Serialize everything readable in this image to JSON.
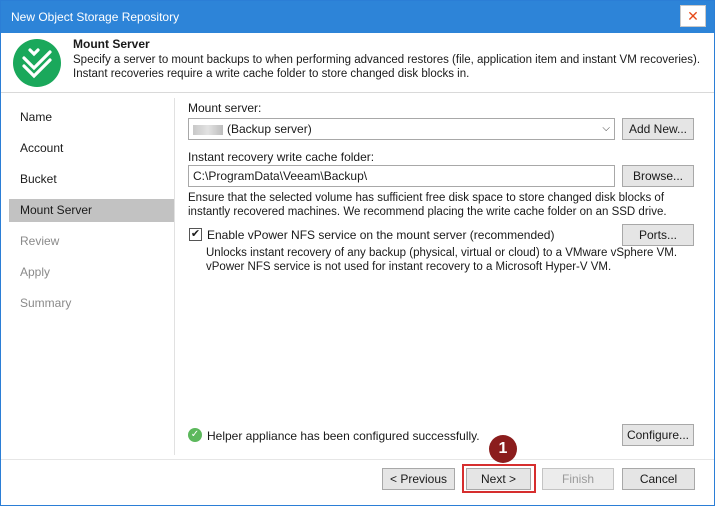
{
  "window": {
    "title": "New Object Storage Repository",
    "close_glyph": "✕"
  },
  "header": {
    "title": "Mount Server",
    "description": "Specify a server to mount backups to when performing advanced restores (file, application item and instant VM recoveries). Instant recoveries require a write cache folder to store changed disk blocks in."
  },
  "nav": {
    "items": [
      {
        "label": "Name"
      },
      {
        "label": "Account"
      },
      {
        "label": "Bucket"
      },
      {
        "label": "Mount Server"
      },
      {
        "label": "Review"
      },
      {
        "label": "Apply"
      },
      {
        "label": "Summary"
      }
    ]
  },
  "mount_server": {
    "label": "Mount server:",
    "value": "(Backup server)",
    "add_new_label": "Add New..."
  },
  "cache_folder": {
    "label": "Instant recovery write cache folder:",
    "value": "C:\\ProgramData\\Veeam\\Backup\\",
    "browse_label": "Browse...",
    "note": "Ensure that the selected volume has sufficient free disk space to store changed disk blocks of instantly recovered machines. We recommend placing the write cache folder on an SSD drive."
  },
  "vpower": {
    "checkbox_label": "Enable vPower NFS service on the mount server (recommended)",
    "checked": true,
    "ports_label": "Ports...",
    "description": "Unlocks instant recovery of any backup (physical, virtual or cloud) to a VMware vSphere VM. vPower NFS service is not used for instant recovery to a Microsoft Hyper-V VM."
  },
  "status": {
    "message": "Helper appliance has been configured successfully.",
    "configure_label": "Configure..."
  },
  "footer": {
    "previous_label": "< Previous",
    "next_label": "Next >",
    "finish_label": "Finish",
    "cancel_label": "Cancel"
  },
  "annotation": {
    "step_number": "1"
  },
  "colors": {
    "accent": "#2d84d8",
    "logo": "#1aa85b",
    "highlight": "#d62e2e",
    "badge": "#8b1d1d"
  }
}
